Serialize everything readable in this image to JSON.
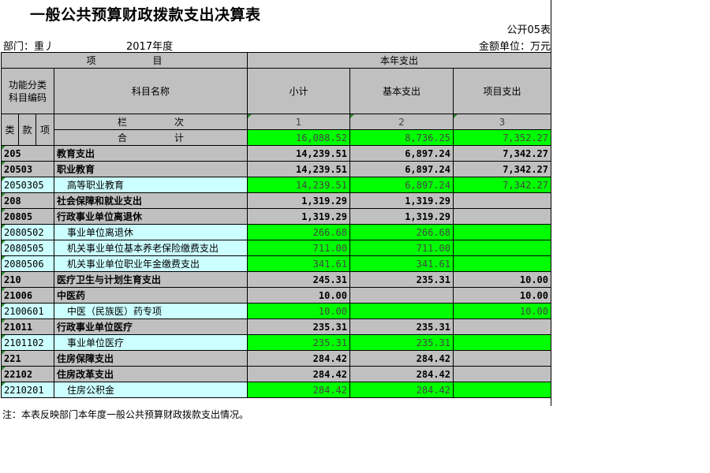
{
  "title": "一般公共预算财政拨款支出决算表",
  "form_no": "公开05表",
  "department": "部门：重丿",
  "year": "2017年度",
  "unit": "金额单位：万元",
  "header": {
    "item": "项　　　　　　目",
    "current_year": "本年支出",
    "func_code": "功能分类\n科目编码",
    "subject_name": "科目名称",
    "subtotal": "小计",
    "basic": "基本支出",
    "project": "项目支出",
    "lei": "类",
    "kuan": "款",
    "xiang": "项",
    "column_no": "栏　　　　　次",
    "col1": "1",
    "col2": "2",
    "col3": "3",
    "total_label": "合　　　　　计"
  },
  "totals": {
    "subtotal": "16,088.52",
    "basic": "8,736.25",
    "project": "7,352.27"
  },
  "rows": [
    {
      "code": "205",
      "name": "教育支出",
      "subtotal": "14,239.51",
      "basic": "6,897.24",
      "project": "7,342.27",
      "level": "lei"
    },
    {
      "code": "20503",
      "name": "职业教育",
      "subtotal": "14,239.51",
      "basic": "6,897.24",
      "project": "7,342.27",
      "level": "kuan"
    },
    {
      "code": "2050305",
      "name": "高等职业教育",
      "subtotal": "14,239.51",
      "basic": "6,897.24",
      "project": "7,342.27",
      "level": "xiang"
    },
    {
      "code": "208",
      "name": "社会保障和就业支出",
      "subtotal": "1,319.29",
      "basic": "1,319.29",
      "project": "",
      "level": "lei"
    },
    {
      "code": "20805",
      "name": "行政事业单位离退休",
      "subtotal": "1,319.29",
      "basic": "1,319.29",
      "project": "",
      "level": "kuan"
    },
    {
      "code": "2080502",
      "name": "事业单位离退休",
      "subtotal": "266.68",
      "basic": "266.68",
      "project": "",
      "level": "xiang"
    },
    {
      "code": "2080505",
      "name": "机关事业单位基本养老保险缴费支出",
      "subtotal": "711.00",
      "basic": "711.00",
      "project": "",
      "level": "xiang"
    },
    {
      "code": "2080506",
      "name": "机关事业单位职业年金缴费支出",
      "subtotal": "341.61",
      "basic": "341.61",
      "project": "",
      "level": "xiang"
    },
    {
      "code": "210",
      "name": "医疗卫生与计划生育支出",
      "subtotal": "245.31",
      "basic": "235.31",
      "project": "10.00",
      "level": "lei"
    },
    {
      "code": "21006",
      "name": "中医药",
      "subtotal": "10.00",
      "basic": "",
      "project": "10.00",
      "level": "kuan"
    },
    {
      "code": "2100601",
      "name": "中医（民族医）药专项",
      "subtotal": "10.00",
      "basic": "",
      "project": "10.00",
      "level": "xiang"
    },
    {
      "code": "21011",
      "name": "行政事业单位医疗",
      "subtotal": "235.31",
      "basic": "235.31",
      "project": "",
      "level": "kuan"
    },
    {
      "code": "2101102",
      "name": "事业单位医疗",
      "subtotal": "235.31",
      "basic": "235.31",
      "project": "",
      "level": "xiang"
    },
    {
      "code": "221",
      "name": "住房保障支出",
      "subtotal": "284.42",
      "basic": "284.42",
      "project": "",
      "level": "lei"
    },
    {
      "code": "22102",
      "name": "住房改革支出",
      "subtotal": "284.42",
      "basic": "284.42",
      "project": "",
      "level": "kuan"
    },
    {
      "code": "2210201",
      "name": "住房公积金",
      "subtotal": "284.42",
      "basic": "284.42",
      "project": "",
      "level": "xiang"
    }
  ],
  "note": "注：本表反映部门本年度一般公共预算财政拨款支出情况。",
  "colors": {
    "header_gray": "#c0c0c0",
    "detail_cyan": "#ccffff",
    "value_green": "#00ff00"
  }
}
